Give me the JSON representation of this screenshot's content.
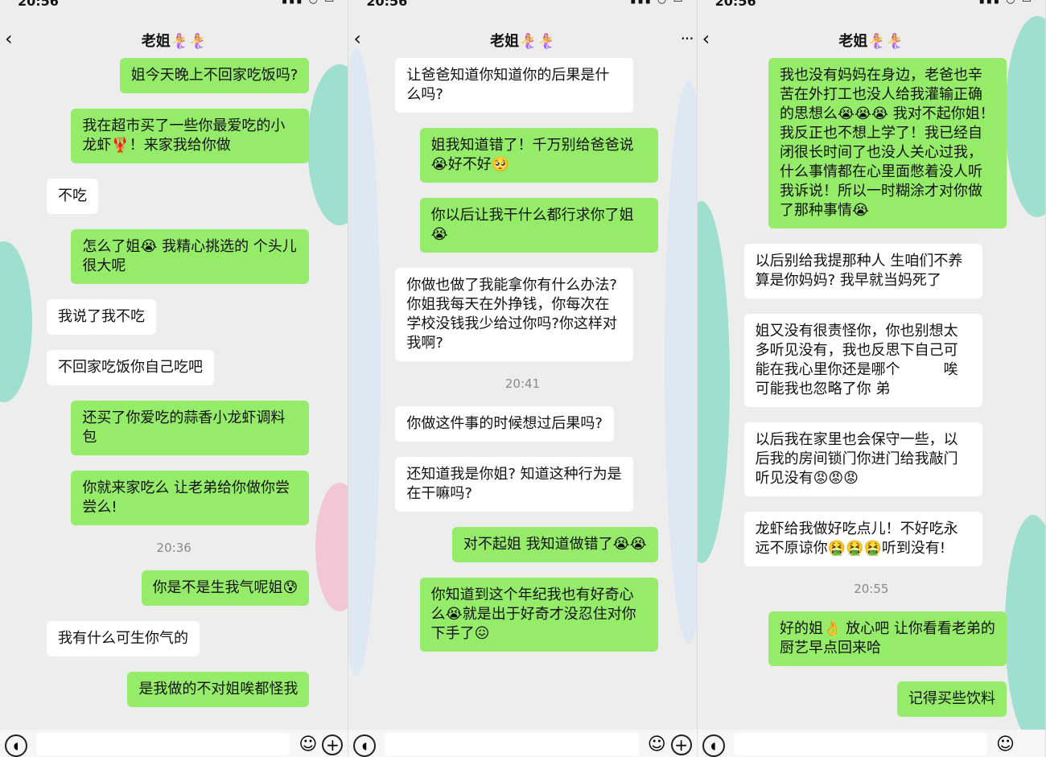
{
  "panels": [
    {
      "status_time": "20:56",
      "title": "老姐🧜‍♀️🧜‍♀️",
      "messages": [
        {
          "side": "right",
          "text": "姐今天晚上不回家吃饭吗?"
        },
        {
          "side": "right",
          "text": "我在超市买了一些你最爱吃的小龙虾🦞！来家我给你做"
        },
        {
          "side": "left",
          "text": "不吃"
        },
        {
          "side": "right",
          "text": "怎么了姐😭 我精心挑选的 个头儿很大呢"
        },
        {
          "side": "left",
          "text": "我说了我不吃"
        },
        {
          "side": "left",
          "text": "不回家吃饭你自己吃吧"
        },
        {
          "side": "right",
          "text": "还买了你爱吃的蒜香小龙虾调料包"
        },
        {
          "side": "right",
          "text": "你就来家吃么 让老弟给你做你尝尝么!"
        },
        {
          "side": "time",
          "text": "20:36"
        },
        {
          "side": "right",
          "text": "你是不是生我气呢姐😰"
        },
        {
          "side": "left",
          "text": "我有什么可生你气的"
        },
        {
          "side": "right",
          "text": "是我做的不对姐唉都怪我"
        }
      ]
    },
    {
      "status_time": "20:56",
      "title": "老姐🧜‍♀️🧜‍♀️",
      "messages": [
        {
          "side": "left",
          "text": "让爸爸知道你知道你的后果是什么吗?"
        },
        {
          "side": "right",
          "text": "姐我知道错了！千万别给爸爸说😭好不好🥺"
        },
        {
          "side": "right",
          "text": "你以后让我干什么都行求你了姐😭"
        },
        {
          "side": "left",
          "text": "你做也做了我能拿你有什么办法?你姐我每天在外挣钱，你每次在学校没钱我少给过你吗?你这样对我啊?"
        },
        {
          "side": "time",
          "text": "20:41"
        },
        {
          "side": "left",
          "text": "你做这件事的时候想过后果吗?"
        },
        {
          "side": "left",
          "text": "还知道我是你姐? 知道这种行为是在干嘛吗?"
        },
        {
          "side": "right",
          "text": "对不起姐 我知道做错了😭😭"
        },
        {
          "side": "right",
          "text": "你知道到这个年纪我也有好奇心么😭就是出于好奇才没忍住对你下手了😖"
        }
      ]
    },
    {
      "status_time": "20:56",
      "title": "老姐🧜‍♀️🧜‍♀️",
      "messages": [
        {
          "side": "right",
          "text": "我也没有妈妈在身边，老爸也辛苦在外打工也没人给我灌输正确的思想么😭😭😭 我对不起你姐！我反正也不想上学了！我已经自闭很长时间了也没人关心过我，什么事情都在心里面憋着没人听我诉说！所以一时糊涂才对你做了那种事情😭"
        },
        {
          "side": "left",
          "text": "以后别给我提那种人 生咱们不养算是你妈妈? 我早就当妈死了"
        },
        {
          "side": "left",
          "text": "姐又没有很责怪你，你也别想太多听见没有，我也反思下自己可能在我心里你还是哪个　　　唉可能我也忽略了你 弟"
        },
        {
          "side": "left",
          "text": "以后我在家里也会保守一些，以后我的房间锁门你进门给我敲门听见没有😡😡😡"
        },
        {
          "side": "left",
          "text": "龙虾给我做好吃点儿！不好吃永远不原谅你🤮🤮🤮听到没有!"
        },
        {
          "side": "time",
          "text": "20:55"
        },
        {
          "side": "right",
          "text": "好的姐👌 放心吧 让你看看老弟的厨艺早点回来哈"
        },
        {
          "side": "right",
          "text": "记得买些饮料"
        }
      ]
    }
  ],
  "icons": {
    "back": "‹",
    "more": "···",
    "voice": "🔊",
    "emoji": "☺",
    "plus": "+"
  },
  "colors": {
    "sent_bubble": "#95ec69",
    "received_bubble": "#ffffff",
    "chat_background": "#ededed"
  }
}
